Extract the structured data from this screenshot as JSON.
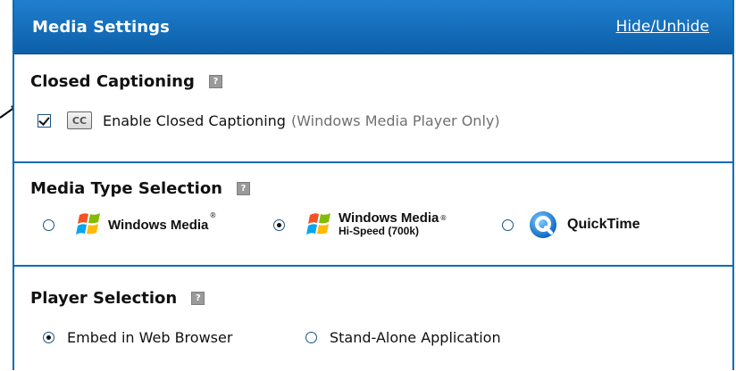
{
  "header": {
    "title": "Media Settings",
    "toggle_link": "Hide/Unhide"
  },
  "closed_captioning": {
    "title": "Closed Captioning",
    "help_glyph": "?",
    "checkbox_checked": true,
    "cc_icon_text": "CC",
    "enable_label": "Enable Closed Captioning",
    "note": "(Windows Media Player Only)"
  },
  "media_type": {
    "title": "Media Type Selection",
    "help_glyph": "?",
    "options": [
      {
        "label": "Windows Media",
        "tm": "®",
        "selected": false,
        "icon": "windows-media-logo-icon"
      },
      {
        "label": "Windows Media",
        "tm": "®",
        "sublabel": "Hi-Speed (700k)",
        "selected": true,
        "icon": "windows-media-logo-icon"
      },
      {
        "label": "QuickTime",
        "selected": false,
        "icon": "quicktime-logo-icon"
      }
    ]
  },
  "player": {
    "title": "Player Selection",
    "help_glyph": "?",
    "options": [
      {
        "label": "Embed in Web Browser",
        "selected": true
      },
      {
        "label": "Stand-Alone Application",
        "selected": false
      }
    ]
  },
  "colors": {
    "accent": "#0a6bb5",
    "header_bg": "#1f7fcf"
  }
}
